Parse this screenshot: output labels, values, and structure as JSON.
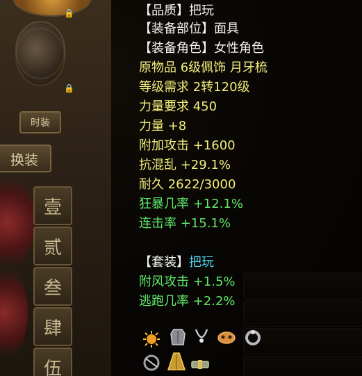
{
  "tooltip": {
    "quality": "【品质】把玩",
    "equip_slot": "【装备部位】面具",
    "equip_role": "【装备角色】女性角色",
    "origin": "原物品 6级佩饰 月牙梳",
    "level_req": "等级需求 2转120级",
    "str_req": "力量要求 450",
    "stat_str": "力量 +8",
    "stat_attack": "附加攻击 +1600",
    "stat_chaos_res": "抗混乱 +29.1%",
    "durability": "耐久 2622/3000",
    "stat_berserk": "狂暴几率 +12.1%",
    "stat_combo": "连击率 +15.1%",
    "set_prefix": "【套装】",
    "set_name": "把玩",
    "set_bonus_wind": "附风攻击 +1.5%",
    "set_bonus_flee": "逃跑几率 +2.2%"
  },
  "background": {
    "btn_small": "时装",
    "btn_swap": "换装",
    "slots": [
      "壹",
      "贰",
      "叁",
      "肆",
      "伍"
    ]
  },
  "set_icons": [
    "sun-pendant-icon",
    "armor-icon",
    "necklace-icon",
    "mask-icon",
    "ring-icon",
    "bracelet-icon",
    "robe-icon",
    "belt-icon"
  ],
  "colors": {
    "white": "#f4f4f0",
    "yellow": "#f2ee7a",
    "green": "#5fe86a",
    "cyan": "#4fd8f0"
  }
}
